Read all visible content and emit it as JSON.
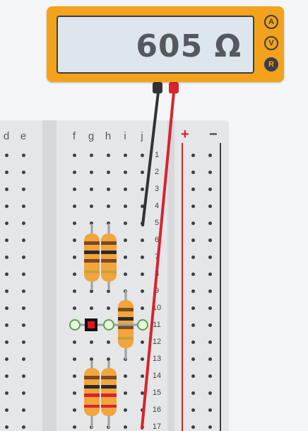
{
  "meter": {
    "reading": "605 Ω",
    "modes": [
      {
        "label": "A",
        "name": "ammeter",
        "active": false
      },
      {
        "label": "V",
        "name": "voltmeter",
        "active": false
      },
      {
        "label": "R",
        "name": "ohmmeter",
        "active": true
      }
    ],
    "probe_colors": {
      "common": "#333333",
      "positive": "#d9232e"
    }
  },
  "breadboard": {
    "column_labels": [
      "d",
      "e",
      "f",
      "g",
      "h",
      "i",
      "j"
    ],
    "rail_labels": {
      "positive": "+",
      "negative": "−"
    },
    "row_numbers": [
      "1",
      "2",
      "3",
      "4",
      "5",
      "6",
      "7",
      "8",
      "9",
      "10",
      "11",
      "12",
      "13",
      "14",
      "15",
      "16",
      "17"
    ]
  },
  "components": {
    "resistors": [
      "resistor-1",
      "resistor-2",
      "resistor-3",
      "resistor-4",
      "resistor-5"
    ],
    "selected_part": "wire-junction"
  }
}
